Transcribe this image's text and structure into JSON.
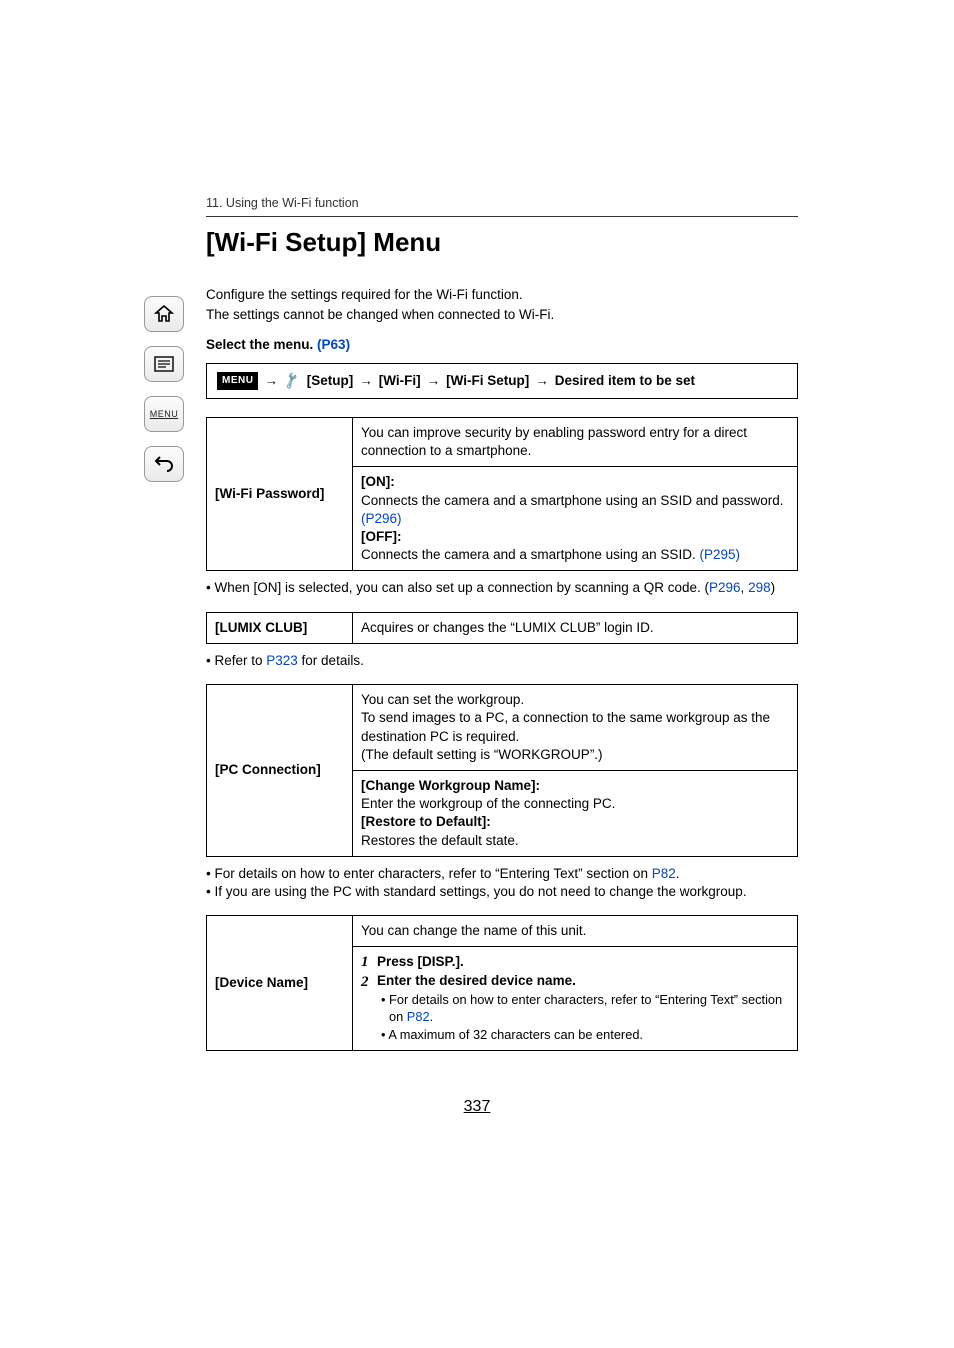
{
  "chapter": "11. Using the Wi-Fi function",
  "title": "[Wi-Fi Setup] Menu",
  "intro1": "Configure the settings required for the Wi-Fi function.",
  "intro2": "The settings cannot be changed when connected to Wi-Fi.",
  "select_menu_label": "Select the menu. ",
  "select_menu_link": "(P63)",
  "menu_badge": "MENU",
  "nav_arrow": " → ",
  "nav_setup": " [Setup] ",
  "nav_wifi": " [Wi-Fi] ",
  "nav_wifisetup": " [Wi-Fi Setup] ",
  "nav_desired": " Desired item to be set",
  "wifi_pw": {
    "label": "[Wi-Fi Password]",
    "row1": "You can improve security by enabling password entry for a direct connection to a smartphone.",
    "on_label": "[ON]:",
    "on_text": "Connects the camera and a smartphone using an SSID and password. ",
    "on_link": "(P296)",
    "off_label": "[OFF]:",
    "off_text": "Connects the camera and a smartphone using an SSID. ",
    "off_link": "(P295)"
  },
  "wifi_pw_note_pre": "When [ON] is selected, you can also set up a connection by scanning a QR code. (",
  "wifi_pw_note_l1": "P296",
  "wifi_pw_note_mid": ", ",
  "wifi_pw_note_l2": "298",
  "wifi_pw_note_post": ")",
  "lumix": {
    "label": "[LUMIX CLUB]",
    "text": "Acquires or changes the “LUMIX CLUB” login ID."
  },
  "lumix_note_pre": "Refer to ",
  "lumix_note_link": "P323",
  "lumix_note_post": " for details.",
  "pc": {
    "label": "[PC Connection]",
    "r1a": "You can set the workgroup.",
    "r1b": "To send images to a PC, a connection to the same workgroup as the destination PC is required.",
    "r1c": "(The default setting is “WORKGROUP”.)",
    "r2a_label": "[Change Workgroup Name]:",
    "r2a_text": "Enter the workgroup of the connecting PC.",
    "r2b_label": "[Restore to Default]:",
    "r2b_text": "Restores the default state."
  },
  "pc_note1_pre": "For details on how to enter characters, refer to “Entering Text” section on ",
  "pc_note1_link": "P82",
  "pc_note1_post": ".",
  "pc_note2": "If you are using the PC with standard settings, you do not need to change the workgroup.",
  "device": {
    "label": "[Device Name]",
    "r1": "You can change the name of this unit.",
    "s1n": "1",
    "s2n": "2",
    "s1": "Press [DISP.].",
    "s2": "Enter the desired device name.",
    "sub1_pre": "For details on how to enter characters, refer to “Entering Text” section on ",
    "sub1_link": "P82",
    "sub1_post": ".",
    "sub2": "A maximum of 32 characters can be entered."
  },
  "page_number": "337",
  "sidebar_menu_label": "MENU"
}
